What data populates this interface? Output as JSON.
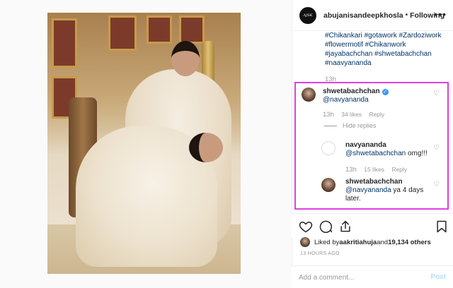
{
  "post": {
    "username": "abujanisandeepkhosla",
    "separator": "•",
    "follow_label": "Following",
    "more_label": "•••",
    "hashtags": "#Chikankari #gotawork #Zardoziwork #flowermotif #Chikanwork #jayabachchan #shwetabachchan #naavyananda",
    "time": "13h",
    "liked_by_prefix": "Liked by ",
    "liked_by_user": "aakritiahuja",
    "liked_by_and": " and ",
    "liked_by_count": "19,134 others",
    "posted_ago": "13 HOURS AGO",
    "comment_placeholder": "Add a comment...",
    "post_label": "Post"
  },
  "comments": [
    {
      "username": "shwetabachchan",
      "mention": "@navyananda",
      "text": "",
      "time": "13h",
      "likes": "34 likes",
      "reply_label": "Reply",
      "hide_replies_label": "Hide replies"
    },
    {
      "username": "navyananda",
      "mention": "@shwetabachchan",
      "text": " omg!!!",
      "time": "13h",
      "likes": "15 likes",
      "reply_label": "Reply"
    },
    {
      "username": "shwetabachchan",
      "mention": "@navyananda",
      "text": " ya 4 days later."
    }
  ],
  "colors": {
    "link": "#003569",
    "highlight": "#e040e0",
    "verified": "#3897f0",
    "post_disabled": "#b2dffc"
  }
}
